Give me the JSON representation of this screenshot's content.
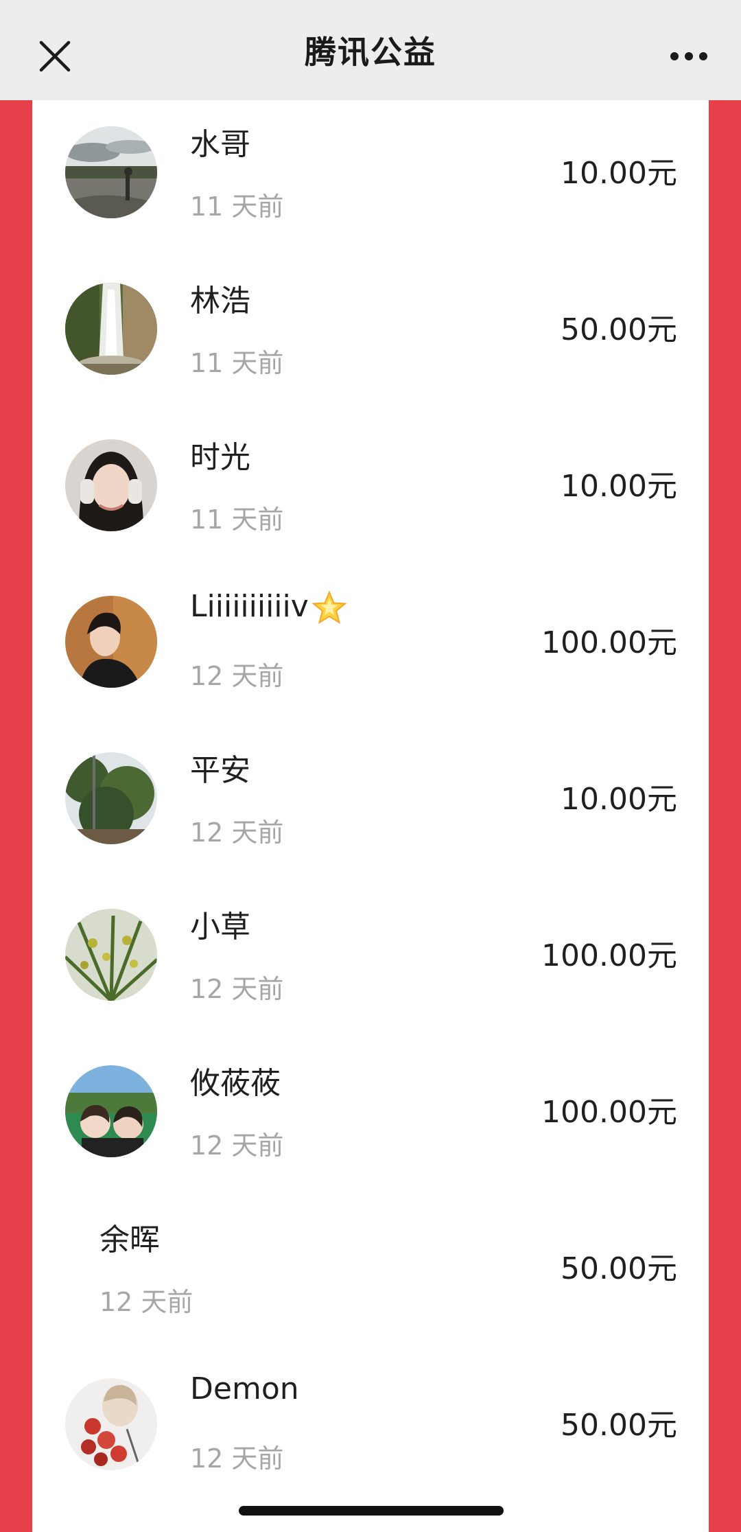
{
  "header": {
    "title": "腾讯公益",
    "close_icon": "close-icon",
    "more_icon": "more-icon"
  },
  "colors": {
    "side_background": "#e8404a",
    "header_background": "#ededed",
    "card_background": "#ffffff"
  },
  "donors": [
    {
      "name": "水哥",
      "time": "11 天前",
      "amount": "10.00元",
      "avatar": "avatar-landscape-icon"
    },
    {
      "name": "林浩",
      "time": "11 天前",
      "amount": "50.00元",
      "avatar": "avatar-waterfall-icon"
    },
    {
      "name": "时光",
      "time": "11 天前",
      "amount": "10.00元",
      "avatar": "avatar-portrait-headphones-icon"
    },
    {
      "name": "Liiiiiiiiiiv",
      "time": "12 天前",
      "amount": "100.00元",
      "avatar": "avatar-portrait-icon",
      "badge": "star-icon"
    },
    {
      "name": "平安",
      "time": "12 天前",
      "amount": "10.00元",
      "avatar": "avatar-trees-icon"
    },
    {
      "name": "小草",
      "time": "12 天前",
      "amount": "100.00元",
      "avatar": "avatar-plant-icon"
    },
    {
      "name": "攸莜莜",
      "time": "12 天前",
      "amount": "100.00元",
      "avatar": "avatar-two-people-icon"
    },
    {
      "name": "余晖",
      "time": "12 天前",
      "amount": "50.00元",
      "avatar": null
    },
    {
      "name": "Demon",
      "time": "12 天前",
      "amount": "50.00元",
      "avatar": "avatar-flowers-icon"
    }
  ]
}
